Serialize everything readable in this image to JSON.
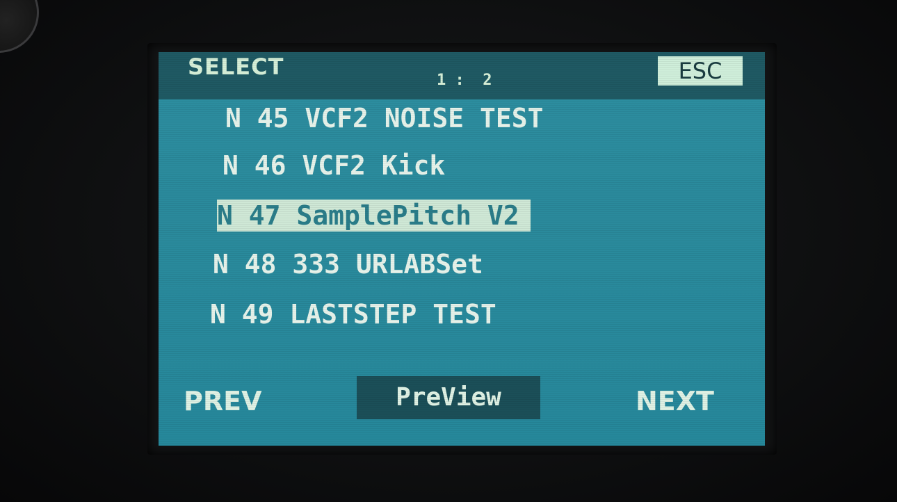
{
  "header": {
    "title": "SELECT",
    "page_counter": "1 :  2",
    "esc_label": "ESC"
  },
  "list": {
    "items": [
      {
        "label": "N 45 VCF2 NOISE TEST"
      },
      {
        "label": "N 46 VCF2 Kick"
      },
      {
        "label": "N 47 SamplePitch V2"
      },
      {
        "label": "N 48 333 URLABSet"
      },
      {
        "label": "N 49 LASTSTEP TEST"
      }
    ],
    "selected_index": 2
  },
  "footer": {
    "prev_label": "PREV",
    "preview_label": "PreView",
    "next_label": "NEXT"
  },
  "colors": {
    "screen_bg": "#2a8a9c",
    "header_bg": "#1f5963",
    "highlight_bg": "#cfe8d6",
    "text": "#e6f2ea"
  }
}
